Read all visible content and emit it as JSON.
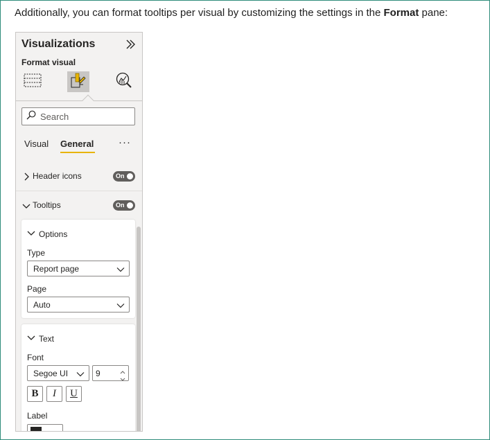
{
  "intro": {
    "text_before": "Additionally, you can format tooltips per visual by customizing the settings in the ",
    "bold": "Format",
    "text_after": " pane:"
  },
  "pane": {
    "title": "Visualizations",
    "subtitle": "Format visual",
    "collapse_icon": "double-chevron-right-icon",
    "tabs": [
      {
        "icon": "build-visual-icon",
        "active": false
      },
      {
        "icon": "format-visual-paintbrush-icon",
        "active": true
      },
      {
        "icon": "analytics-magnifier-icon",
        "active": false
      }
    ],
    "search_placeholder": "Search",
    "subtabs": {
      "visual": "Visual",
      "general": "General",
      "active": "General"
    },
    "more_label": "···",
    "sections": {
      "header_icons": {
        "label": "Header icons",
        "toggle": "On",
        "expanded": false
      },
      "tooltips": {
        "label": "Tooltips",
        "toggle": "On",
        "expanded": true
      }
    },
    "options_card": {
      "title": "Options",
      "type_label": "Type",
      "type_value": "Report page",
      "page_label": "Page",
      "page_value": "Auto"
    },
    "text_card": {
      "title": "Text",
      "font_label": "Font",
      "font_family": "Segoe UI",
      "font_size": "9",
      "bold_label": "B",
      "italic_label": "I",
      "underline_label": "U",
      "color_label": "Label",
      "color_value": "#252423"
    },
    "colors": {
      "accent": "#e8b400",
      "toggle": "#605e5c",
      "border": "#2e8b7a"
    }
  }
}
